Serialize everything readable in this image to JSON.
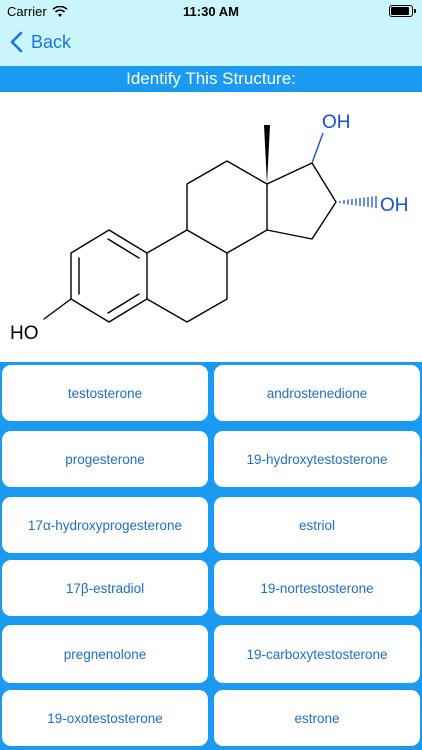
{
  "status_bar": {
    "carrier": "Carrier",
    "time": "11:30 AM",
    "battery_level": 1.0
  },
  "nav": {
    "back_label": "Back",
    "back_icon": "chevron-left-icon"
  },
  "quiz": {
    "title": "Identify This Structure:",
    "structure_labels": {
      "oh_top": "OH",
      "oh_right": "OH",
      "ho_left": "HO"
    },
    "choices": [
      "testosterone",
      "androstenedione",
      "progesterone",
      "19-hydroxytestosterone",
      "17α-hydroxyprogesterone",
      "estriol",
      "17β-estradiol",
      "19-nortestosterone",
      "pregnenolone",
      "19-carboxytestosterone",
      "19-oxotestosterone",
      "estrone"
    ]
  },
  "colors": {
    "accent_blue": "#1a9af0",
    "header_bg": "#caf5fb",
    "choice_text": "#1d6fc9",
    "oh_blue": "#1a4fd6"
  }
}
